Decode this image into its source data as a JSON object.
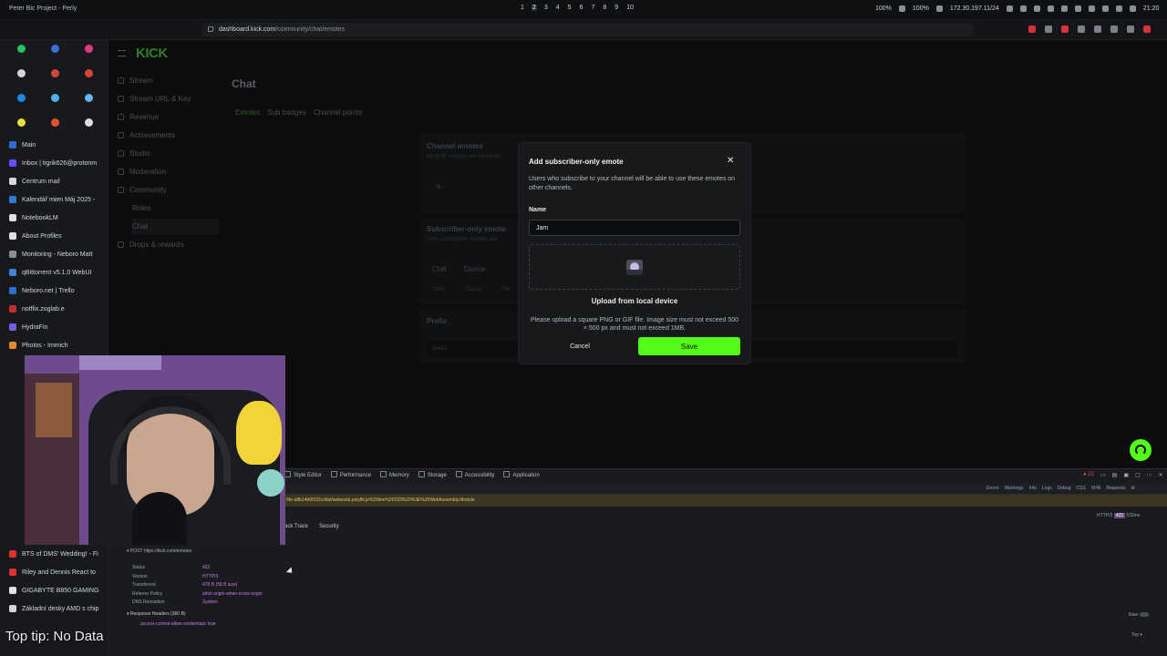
{
  "topbar": {
    "window_title": "Peter Bic Project - Perly",
    "workspaces": [
      "1",
      "2",
      "3",
      "4",
      "5",
      "6",
      "7",
      "8",
      "9",
      "10"
    ],
    "battery1": "100%",
    "battery2": "100%",
    "ip": "172.30.197.11/24",
    "clock": "21:20"
  },
  "browser": {
    "url_host": "dashboard.kick.com",
    "url_path": "/community/chat/emotes"
  },
  "sidebar": {
    "pinned": [
      {
        "icon": "green-app-icon",
        "color": "#25c25e"
      },
      {
        "icon": "mail-icon",
        "color": "#3b6fd8"
      },
      {
        "icon": "instagram-icon",
        "color": "#e23a8a"
      },
      {
        "icon": "x-icon",
        "color": "#d6d6d6"
      },
      {
        "icon": "gmail-icon",
        "color": "#d44638"
      },
      {
        "icon": "gmail-icon",
        "color": "#d44638"
      },
      {
        "icon": "messenger-icon",
        "color": "#1e88e5"
      },
      {
        "icon": "drop-icon",
        "color": "#4fb3e8"
      },
      {
        "icon": "docs-icon",
        "color": "#62b6f0"
      },
      {
        "icon": "yellow-app-icon",
        "color": "#e7e13a"
      },
      {
        "icon": "gitlab-icon",
        "color": "#e2552a"
      },
      {
        "icon": "github-icon",
        "color": "#e0e0e0"
      }
    ],
    "tabs": [
      {
        "label": "Main",
        "color": "#2f6bd6"
      },
      {
        "label": "Inbox | tigrik626@protonm",
        "color": "#6d4aff"
      },
      {
        "label": "Centrum mail",
        "color": "#d6d6d6"
      },
      {
        "label": "Kalendář mien Máj 2025 -",
        "color": "#2e7dd8"
      },
      {
        "label": "NotebookLM",
        "color": "#e0e0e0"
      },
      {
        "label": "About Profiles",
        "color": "#e0e0e0"
      },
      {
        "label": "Monitoring - Neboro Matt",
        "color": "#8a8f96"
      },
      {
        "label": "qBittorrent v5.1.0 WebUI",
        "color": "#3c82d8"
      },
      {
        "label": "Neboro.net | Trello",
        "color": "#2a6fd0"
      },
      {
        "label": "notflix.zoglab.e",
        "color": "#c03030"
      },
      {
        "label": "HydraFin",
        "color": "#7b5ce0"
      },
      {
        "label": "Photos - Immich",
        "color": "#e08a2a"
      }
    ],
    "bottom_tabs": [
      {
        "label": "BTS of DMS' Wedding! - Fi",
        "color": "#e03030"
      },
      {
        "label": "Riley and Dennis React to",
        "color": "#e03030"
      },
      {
        "label": "GIGABYTE B850 GAMING",
        "color": "#e0e0e0"
      },
      {
        "label": "Základní desky AMD s chip",
        "color": "#d6d6d6"
      }
    ]
  },
  "kick": {
    "nav": [
      "Stream",
      "Stream URL & Key",
      "Revenue",
      "Achievements",
      "Studio",
      "Moderation",
      "Community"
    ],
    "community_sub": [
      "Roles",
      "Chat"
    ],
    "drops": "Drops & rewards",
    "page_title": "Chat",
    "tabs": [
      "Emotes",
      "Sub badges",
      "Channel points"
    ],
    "channel_emotes": "Channel emotes",
    "channel_emotes_sub": "Up to 90 emotes are saved ea",
    "subscriber_only": "Subscriber-only emote",
    "subscriber_only_sub": "Little subscription emotes are",
    "emote1": "Chill",
    "emote2": "Dance",
    "emote1_small": "Chill",
    "emote2_small": "Dance",
    "emote3_small": "Fel",
    "prefix_label": "Prefix",
    "prefix_value": "pokk2"
  },
  "modal": {
    "title": "Add subscriber-only emote",
    "description": "Users who subscribe to your channel will be able to use these emotes on other channels.",
    "name_label": "Name",
    "name_value": "Jam",
    "upload_link": "Upload from local device",
    "upload_hint": "Please upload a square PNG or GIF file. Image size must not exceed 500 × 500 px and must not exceed 1MB.",
    "cancel": "Cancel",
    "save": "Save"
  },
  "devtools": {
    "tabs": [
      "Style Editor",
      "Performance",
      "Memory",
      "Storage",
      "Accessibility",
      "Application"
    ],
    "error_count": "22",
    "filters": [
      "Errors",
      "Warnings",
      "Info",
      "Logs",
      "Debug"
    ],
    "filters_plain": [
      "CSS",
      "XHR",
      "Requests"
    ],
    "request_url": "5fe-a8b14b0f102c/dist/webexial.polyfill.js%20line%20183%20%3E%20WebAssembly.Module",
    "protocol": "HTTP/3",
    "status_code": "422",
    "timing": "532ms",
    "subtabs": [
      "ack Trace",
      "Security"
    ],
    "post_label": "POST",
    "post_url": "https://kick.com/emotes",
    "rows": [
      {
        "key": "Status",
        "value": "422"
      },
      {
        "key": "Version",
        "value": "HTTP/3"
      },
      {
        "key": "Transferred",
        "value": "478 B (58 B size)"
      },
      {
        "key": "Referrer Policy",
        "value": "strict-origin-when-cross-origin"
      },
      {
        "key": "DNS Resolution",
        "value": "System"
      }
    ],
    "response_headers": "Response Headers (380 B)",
    "allow_credentials": "access-control-allow-credentials: true",
    "raw": "Raw",
    "top": "Top"
  },
  "caption": "Top tip: No Data"
}
